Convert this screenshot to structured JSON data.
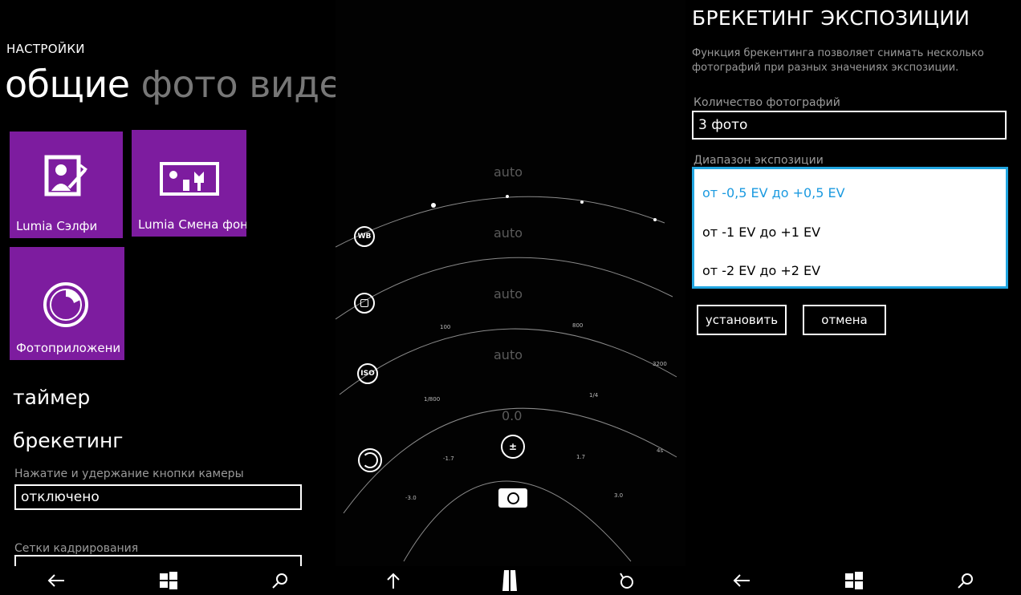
{
  "left": {
    "header": "НАСТРОЙКИ",
    "pivot": {
      "active": "общие",
      "inactive1": "фото",
      "inactive2": "виде"
    },
    "tiles": [
      {
        "label": "Lumia Сэлфи",
        "icon": "selfie-icon"
      },
      {
        "label": "Lumia Смена фон",
        "icon": "photo-swap-icon"
      },
      {
        "label": "Фотоприложени",
        "icon": "camera-lens-icon"
      }
    ],
    "sections": {
      "timer": "таймер",
      "bracketing": "брекетинг"
    },
    "camera_button_label": "Нажатие и удержание кнопки камеры",
    "camera_button_value": "отключено",
    "grid_label": "Сетки кадрирования"
  },
  "camera": {
    "wb_label": "auto",
    "focus_label": "auto",
    "iso_label": "auto",
    "shutter_label": "auto",
    "ev_label": "0.0",
    "wb_button": "WB",
    "iso_button": "ISO",
    "ticks": {
      "iso_low": "100",
      "iso_mid": "800",
      "iso_high": "3200",
      "shutter_low": "1/800",
      "shutter_mid": "1/4",
      "shutter_high": "4s",
      "ev_m17": "-1.7",
      "ev_p17": "1.7",
      "ev_m30": "-3.0",
      "ev_p30": "3.0"
    }
  },
  "right": {
    "title": "БРЕКЕТИНГ ЭКСПОЗИЦИИ",
    "description": "Функция брекентинга позволяет снимать несколько фотографий при разных значениях экспозиции.",
    "count_label": "Количество фотографий",
    "count_value": "3 фото",
    "range_label": "Диапазон экспозиции",
    "options": [
      "от -0,5 EV до +0,5 EV",
      "от -1 EV до +1 EV",
      "от -2 EV до +2 EV"
    ],
    "install_button": "установить",
    "cancel_button": "отмена"
  },
  "colors": {
    "tile": "#7d1c9f",
    "accent": "#21a5e0",
    "selected_text": "#1b9ae0"
  }
}
